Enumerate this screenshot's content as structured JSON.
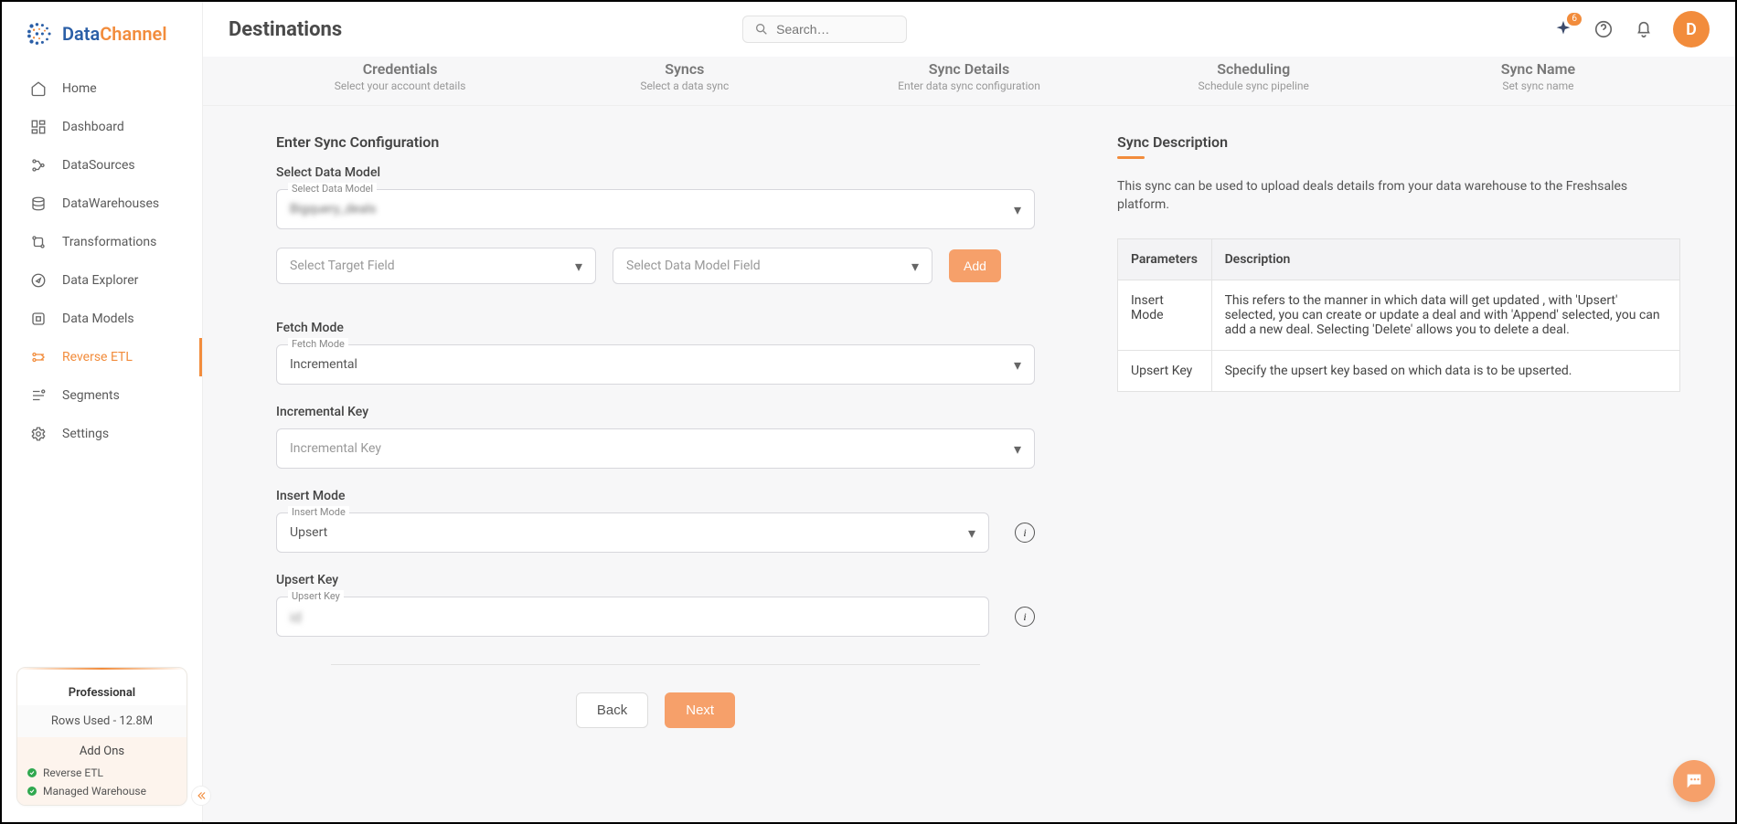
{
  "logo": {
    "part1": "Data",
    "part2": "Channel"
  },
  "nav": {
    "items": [
      {
        "label": "Home"
      },
      {
        "label": "Dashboard"
      },
      {
        "label": "DataSources"
      },
      {
        "label": "DataWarehouses"
      },
      {
        "label": "Transformations"
      },
      {
        "label": "Data Explorer"
      },
      {
        "label": "Data Models"
      },
      {
        "label": "Reverse ETL"
      },
      {
        "label": "Segments"
      },
      {
        "label": "Settings"
      }
    ]
  },
  "plan": {
    "name": "Professional",
    "rows": "Rows Used - 12.8M",
    "addons_head": "Add Ons",
    "addons": [
      "Reverse ETL",
      "Managed Warehouse"
    ]
  },
  "header": {
    "title": "Destinations",
    "search_placeholder": "Search…",
    "badge": "6",
    "avatar": "D"
  },
  "stepper": [
    {
      "title": "Credentials",
      "sub": "Select your account details"
    },
    {
      "title": "Syncs",
      "sub": "Select a data sync"
    },
    {
      "title": "Sync Details",
      "sub": "Enter data sync configuration"
    },
    {
      "title": "Scheduling",
      "sub": "Schedule sync pipeline"
    },
    {
      "title": "Sync Name",
      "sub": "Set sync name"
    }
  ],
  "form": {
    "section_head": "Enter Sync Configuration",
    "data_model": {
      "label": "Select Data Model",
      "float": "Select Data Model",
      "value": "Bigquery_deals"
    },
    "target_field_placeholder": "Select Target Field",
    "model_field_placeholder": "Select Data Model Field",
    "add_btn": "Add",
    "fetch_mode": {
      "label": "Fetch Mode",
      "float": "Fetch Mode",
      "value": "Incremental"
    },
    "incremental_key": {
      "label": "Incremental Key",
      "placeholder": "Incremental Key"
    },
    "insert_mode": {
      "label": "Insert Mode",
      "float": "Insert Mode",
      "value": "Upsert"
    },
    "upsert_key": {
      "label": "Upsert Key",
      "float": "Upsert Key",
      "value": "id"
    },
    "back_btn": "Back",
    "next_btn": "Next"
  },
  "desc": {
    "title": "Sync Description",
    "text": "This sync can be used to upload deals details from your data warehouse to the Freshsales platform.",
    "th_param": "Parameters",
    "th_desc": "Description",
    "rows": [
      {
        "p": "Insert Mode",
        "d": "This refers to the manner in which data will get updated , with 'Upsert' selected, you can create or update a deal and with 'Append' selected, you can add a new deal. Selecting 'Delete' allows you to delete a deal."
      },
      {
        "p": "Upsert Key",
        "d": "Specify the upsert key based on which data is to be upserted."
      }
    ]
  }
}
